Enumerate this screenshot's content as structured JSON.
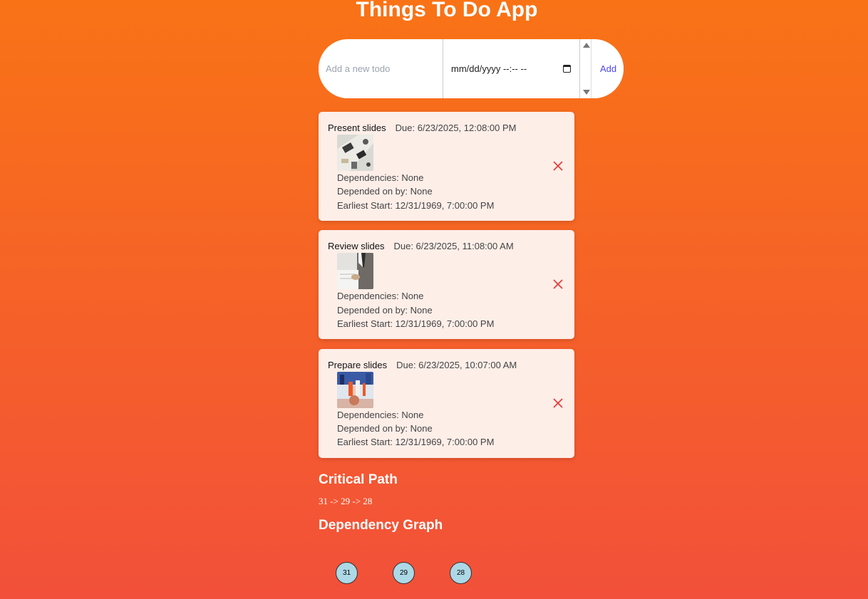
{
  "app": {
    "title": "Things To Do App"
  },
  "form": {
    "todo_placeholder": "Add a new todo",
    "date_placeholder": "mm/dd/yyyy --:-- --",
    "add_label": "Add"
  },
  "todos": [
    {
      "title": "Present slides",
      "due": "Due: 6/23/2025, 12:08:00 PM",
      "dependencies": "Dependencies: None",
      "depended_on_by": "Depended on by: None",
      "earliest_start": "Earliest Start: 12/31/1969, 7:00:00 PM",
      "thumbnail": "office-desk-photo"
    },
    {
      "title": "Review slides",
      "due": "Due: 6/23/2025, 11:08:00 AM",
      "dependencies": "Dependencies: None",
      "depended_on_by": "Depended on by: None",
      "earliest_start": "Earliest Start: 12/31/1969, 7:00:00 PM",
      "thumbnail": "businessman-papers-photo"
    },
    {
      "title": "Prepare slides",
      "due": "Due: 6/23/2025, 10:07:00 AM",
      "dependencies": "Dependencies: None",
      "depended_on_by": "Depended on by: None",
      "earliest_start": "Earliest Start: 12/31/1969, 7:00:00 PM",
      "thumbnail": "gym-exercise-photo"
    }
  ],
  "critical_path": {
    "heading": "Critical Path",
    "value": "31 -> 29 -> 28"
  },
  "dependency_graph": {
    "heading": "Dependency Graph",
    "nodes": [
      "31",
      "29",
      "28"
    ]
  },
  "colors": {
    "gradient_top": "#f97316",
    "gradient_bottom": "#f2503a",
    "card_bg": "#fdeee8",
    "delete_red": "#e53e3e",
    "add_text": "#4f46e5",
    "node_fill": "#add8e6"
  }
}
